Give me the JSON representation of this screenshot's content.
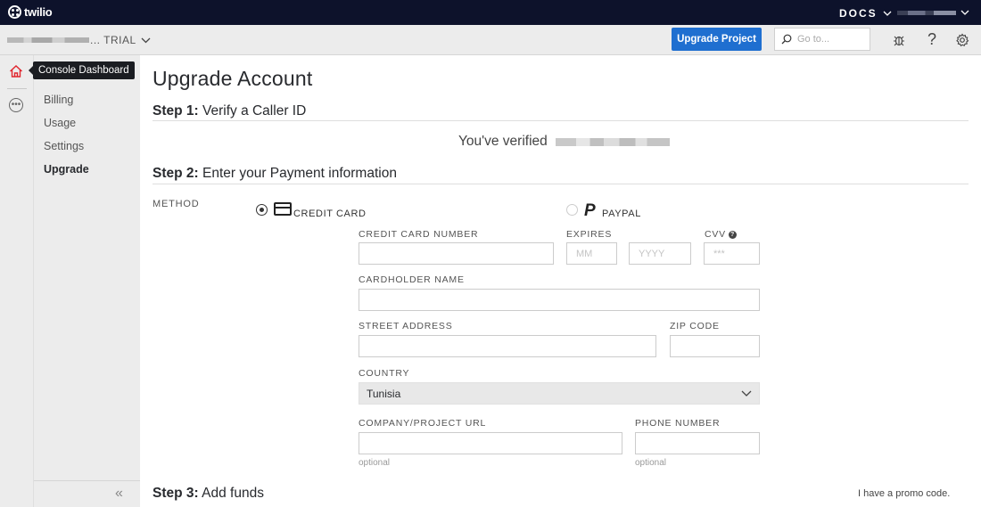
{
  "topbar": {
    "logo_text": "twilio",
    "docs_label": "DOCS"
  },
  "subbar": {
    "project_suffix": "... TRIAL",
    "upgrade_button": "Upgrade Project",
    "search_placeholder": "Go to..."
  },
  "sidebar": {
    "tooltip": "Console Dashboard",
    "items": [
      {
        "label": "Billing"
      },
      {
        "label": "Usage"
      },
      {
        "label": "Settings"
      },
      {
        "label": "Upgrade",
        "active": true
      }
    ]
  },
  "main": {
    "title": "Upgrade Account",
    "step1": {
      "number": "Step 1:",
      "text": " Verify a Caller ID"
    },
    "verified_text": "You've verified",
    "step2": {
      "number": "Step 2:",
      "text": " Enter your Payment information"
    },
    "method_label": "METHOD",
    "credit_card_label": "CREDIT CARD",
    "paypal_label": "PAYPAL",
    "form": {
      "card_number_label": "CREDIT CARD NUMBER",
      "expires_label": "EXPIRES",
      "month_placeholder": "MM",
      "year_placeholder": "YYYY",
      "cvv_label": "CVV",
      "cvv_placeholder": "***",
      "cardholder_label": "CARDHOLDER NAME",
      "street_label": "STREET ADDRESS",
      "zip_label": "ZIP CODE",
      "country_label": "COUNTRY",
      "country_value": "Tunisia",
      "company_url_label": "COMPANY/PROJECT URL",
      "phone_label": "PHONE NUMBER",
      "optional_hint": "optional"
    },
    "step3": {
      "number": "Step 3:",
      "text": " Add funds"
    },
    "promo_link": "I have a promo code."
  },
  "colors": {
    "topbar_bg": "#0d122b",
    "accent_blue": "#1f6fd0",
    "home_icon_red": "#e0242c"
  }
}
